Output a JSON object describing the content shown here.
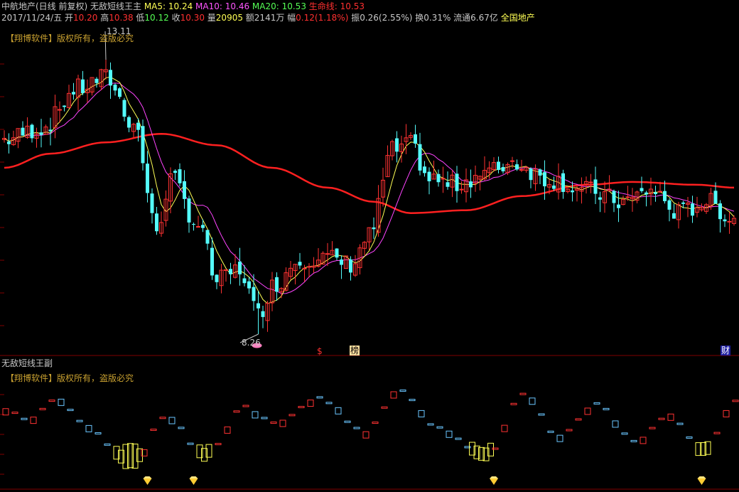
{
  "header": {
    "line1": [
      {
        "text": "中航地产(日线 前复权) 无敌短线王主",
        "color": "#c8c8c8"
      },
      {
        "text": "  MA5: 10.24",
        "color": "#ffff55"
      },
      {
        "text": "  MA10: 10.46",
        "color": "#ff55ff"
      },
      {
        "text": "  MA20: 10.53",
        "color": "#55ff55"
      },
      {
        "text": "  生命线: 10.53",
        "color": "#ff3030"
      }
    ],
    "line2": [
      {
        "text": "2017/11/24/五 ",
        "color": "#c8c8c8"
      },
      {
        "text": "开",
        "color": "#c8c8c8"
      },
      {
        "text": "10.20 ",
        "color": "#ff3030"
      },
      {
        "text": "高",
        "color": "#c8c8c8"
      },
      {
        "text": "10.38 ",
        "color": "#ff3030"
      },
      {
        "text": "低",
        "color": "#c8c8c8"
      },
      {
        "text": "10.12 ",
        "color": "#55ff55"
      },
      {
        "text": "收",
        "color": "#c8c8c8"
      },
      {
        "text": "10.30 ",
        "color": "#ff3030"
      },
      {
        "text": "量",
        "color": "#c8c8c8"
      },
      {
        "text": "20905 ",
        "color": "#ffff55"
      },
      {
        "text": "额2141万 ",
        "color": "#c8c8c8"
      },
      {
        "text": "幅",
        "color": "#c8c8c8"
      },
      {
        "text": "0.12(1.18%) ",
        "color": "#ff3030"
      },
      {
        "text": "振0.26(2.55%) ",
        "color": "#c8c8c8"
      },
      {
        "text": "换0.31% ",
        "color": "#c8c8c8"
      },
      {
        "text": "流通6.67亿 ",
        "color": "#c8c8c8"
      },
      {
        "text": "全国地产",
        "color": "#ffff55"
      }
    ],
    "copyright_main": "【翔博软件】版权所有，盗版必究",
    "copyright_sub": "【翔博软件】版权所有，盗版必究",
    "sub_title": "无敌短线王副"
  },
  "labels": {
    "high_price": "13.11",
    "low_price": "8.26",
    "mark_dollar": "$",
    "mark_bang": "榜",
    "mark_cai": "财"
  },
  "colors": {
    "up": "#ff3232",
    "down": "#54fcfc",
    "ma5": "#ffff55",
    "ma10": "#ff44ff",
    "life": "#ff2020",
    "grid": "#800000",
    "text": "#c8c8c8",
    "gold": "#c8a030",
    "sub_red": "#ff3232",
    "sub_blue": "#6ac6ff",
    "sub_yellow": "#ffff55"
  },
  "chart_data": {
    "type": "candlestick",
    "price_range": [
      8.26,
      13.11
    ],
    "key_prices": {
      "highest": 13.11,
      "lowest": 8.26,
      "last_close": 10.3,
      "ma5": 10.24,
      "ma10": 10.46,
      "ma20": 10.53,
      "life_line": 10.53
    },
    "trend_anchors": [
      [
        0,
        11.7
      ],
      [
        8,
        11.9
      ],
      [
        16,
        12.6
      ],
      [
        22,
        12.8
      ],
      [
        28,
        12.0
      ],
      [
        33,
        10.1
      ],
      [
        36,
        11.0
      ],
      [
        42,
        10.2
      ],
      [
        46,
        9.2
      ],
      [
        51,
        9.4
      ],
      [
        55,
        8.6
      ],
      [
        58,
        9.1
      ],
      [
        64,
        9.6
      ],
      [
        70,
        9.6
      ],
      [
        75,
        9.5
      ],
      [
        79,
        10.0
      ],
      [
        84,
        11.5
      ],
      [
        88,
        11.6
      ],
      [
        92,
        11.0
      ],
      [
        97,
        10.9
      ],
      [
        104,
        11.1
      ],
      [
        110,
        11.3
      ],
      [
        118,
        11.0
      ],
      [
        126,
        10.8
      ],
      [
        134,
        10.6
      ],
      [
        140,
        10.8
      ],
      [
        146,
        10.4
      ],
      [
        152,
        10.6
      ],
      [
        158,
        10.3
      ]
    ],
    "life_anchors": [
      [
        0,
        11.2
      ],
      [
        10,
        11.45
      ],
      [
        22,
        11.65
      ],
      [
        34,
        11.8
      ],
      [
        46,
        11.6
      ],
      [
        58,
        11.2
      ],
      [
        70,
        10.85
      ],
      [
        80,
        10.6
      ],
      [
        88,
        10.4
      ],
      [
        100,
        10.45
      ],
      [
        112,
        10.7
      ],
      [
        126,
        10.9
      ],
      [
        136,
        10.95
      ],
      [
        150,
        10.9
      ],
      [
        158,
        10.85
      ]
    ],
    "sub_anchors": [
      [
        0,
        0.7
      ],
      [
        5,
        0.6
      ],
      [
        11,
        0.85
      ],
      [
        17,
        0.55
      ],
      [
        27,
        0.05
      ],
      [
        35,
        0.65
      ],
      [
        43,
        0.15
      ],
      [
        52,
        0.75
      ],
      [
        58,
        0.55
      ],
      [
        68,
        0.85
      ],
      [
        78,
        0.45
      ],
      [
        85,
        0.95
      ],
      [
        94,
        0.5
      ],
      [
        104,
        0.15
      ],
      [
        112,
        0.9
      ],
      [
        120,
        0.4
      ],
      [
        128,
        0.8
      ],
      [
        136,
        0.35
      ],
      [
        144,
        0.65
      ],
      [
        151,
        0.2
      ],
      [
        158,
        0.8
      ]
    ],
    "diamond_positions": [
      31,
      41,
      106,
      151
    ]
  }
}
